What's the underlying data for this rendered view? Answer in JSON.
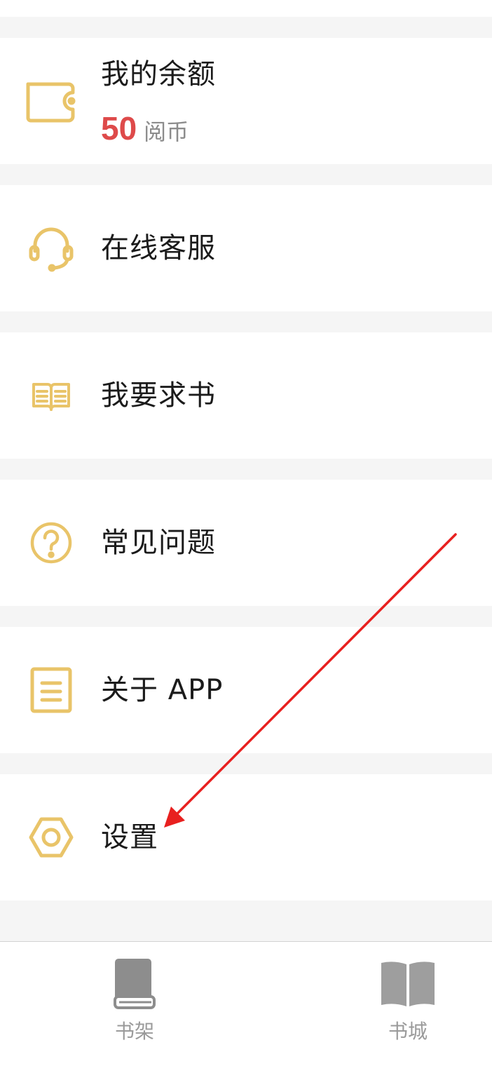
{
  "balance": {
    "title": "我的余额",
    "amount": "50",
    "unit": "阅币",
    "icon": "wallet-icon"
  },
  "menu": [
    {
      "label": "在线客服",
      "icon": "headset-icon"
    },
    {
      "label": "我要求书",
      "icon": "open-book-icon"
    },
    {
      "label": "常见问题",
      "icon": "question-circle-icon"
    },
    {
      "label": "关于 APP",
      "icon": "document-icon"
    },
    {
      "label": "设置",
      "icon": "gear-icon"
    }
  ],
  "tabbar": {
    "items": [
      {
        "label": "书架",
        "icon": "bookshelf-icon"
      },
      {
        "label": "书城",
        "icon": "bookstore-icon"
      }
    ]
  },
  "annotation": {
    "arrow_target": "设置",
    "arrow_color": "#e8201f"
  },
  "colors": {
    "accent_gold": "#e9c469",
    "balance_red": "#de4a4a",
    "row_bg": "#ffffff",
    "page_bg": "#f5f5f5",
    "tab_gray": "#9a9a9a"
  }
}
